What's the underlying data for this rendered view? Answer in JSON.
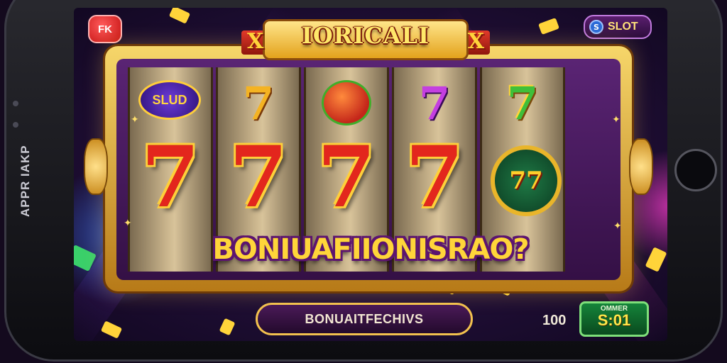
{
  "device": {
    "side_label": "APPR IAKP"
  },
  "game": {
    "top_left_badge": "FK",
    "top_right_badge_icon": "S",
    "top_right_badge": "SLOT",
    "title": "IORICALI",
    "banner_x_left": "X",
    "banner_x_right": "X",
    "reels": [
      {
        "top": "SLUD",
        "middle": "7"
      },
      {
        "top": "7",
        "middle": "7"
      },
      {
        "top": "",
        "middle": "7"
      },
      {
        "top": "7",
        "middle": "7"
      },
      {
        "top": "7",
        "middle": "77"
      }
    ],
    "bonus_text": "BONIUAFIIONISRAO?",
    "button_label": "BONUAITFECHIVS",
    "bet_value": "100",
    "win_label": "OMMER",
    "win_value": "S:01"
  },
  "colors": {
    "reel_seven_red": "#e3261d",
    "reel_seven_gold": "#ffcf3a",
    "accent_purple": "#5a2474",
    "accent_gold": "#f2c14e",
    "win_green": "#15843a"
  }
}
